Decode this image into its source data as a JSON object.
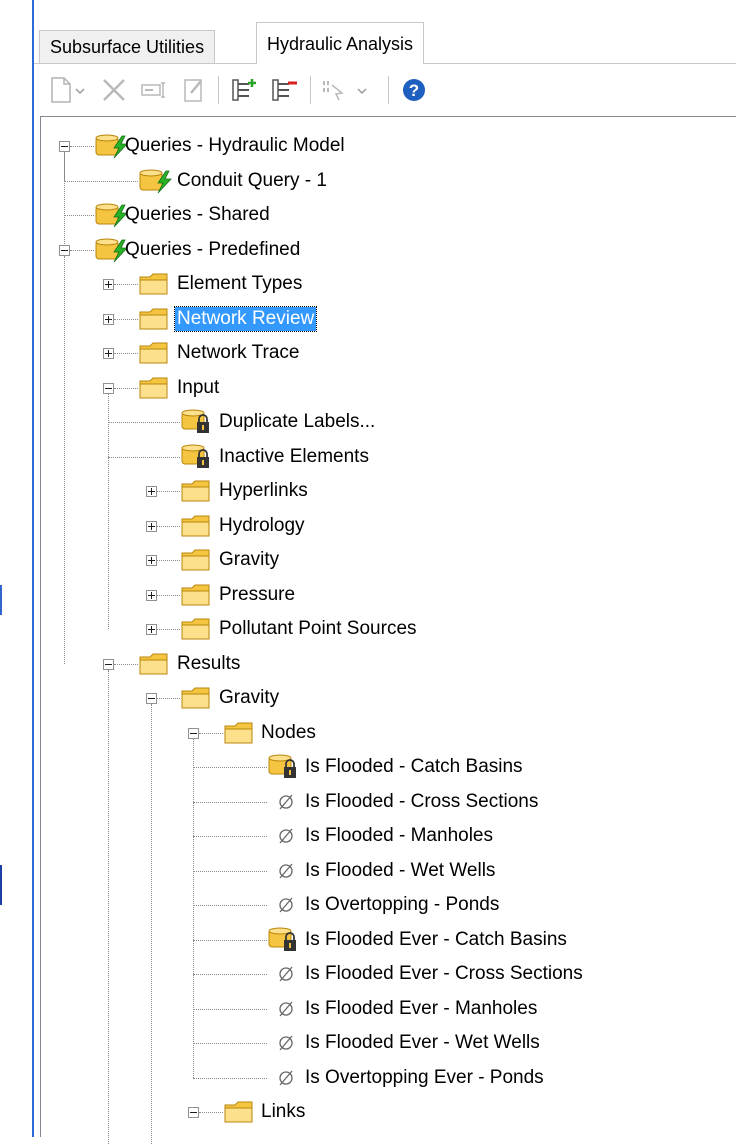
{
  "tabs": [
    {
      "label": "Subsurface Utilities",
      "active": false
    },
    {
      "label": "Hydraulic Analysis",
      "active": true
    }
  ],
  "toolbar": [
    {
      "icon": "new-document-icon",
      "dropdown": true,
      "enabled": false
    },
    {
      "icon": "delete-icon",
      "enabled": false
    },
    {
      "icon": "rename-icon",
      "enabled": false
    },
    {
      "icon": "edit-icon",
      "enabled": false
    },
    {
      "icon": "expand-all-icon",
      "enabled": true
    },
    {
      "icon": "collapse-all-icon",
      "enabled": true
    },
    {
      "icon": "select-icon",
      "dropdown": true,
      "enabled": false
    },
    {
      "icon": "help-icon",
      "enabled": true
    }
  ],
  "tree": [
    {
      "label": "Queries - Hydraulic Model",
      "level": 0,
      "icon": "query-group-icon",
      "expander": "minus"
    },
    {
      "label": "Conduit Query - 1",
      "level": 1,
      "icon": "query-group-icon"
    },
    {
      "label": "Queries - Shared",
      "level": 0,
      "icon": "query-group-icon"
    },
    {
      "label": "Queries - Predefined",
      "level": 0,
      "icon": "query-group-icon",
      "expander": "minus"
    },
    {
      "label": "Element Types",
      "level": 1,
      "icon": "folder-icon",
      "expander": "plus"
    },
    {
      "label": "Network Review",
      "level": 1,
      "icon": "folder-icon",
      "expander": "plus",
      "selected": true
    },
    {
      "label": "Network Trace",
      "level": 1,
      "icon": "folder-icon",
      "expander": "plus"
    },
    {
      "label": "Input",
      "level": 1,
      "icon": "folder-icon",
      "expander": "minus"
    },
    {
      "label": "Duplicate Labels...",
      "level": 2,
      "icon": "locked-query-icon"
    },
    {
      "label": "Inactive Elements",
      "level": 2,
      "icon": "locked-query-icon"
    },
    {
      "label": "Hyperlinks",
      "level": 2,
      "icon": "folder-icon",
      "expander": "plus"
    },
    {
      "label": "Hydrology",
      "level": 2,
      "icon": "folder-icon",
      "expander": "plus"
    },
    {
      "label": "Gravity",
      "level": 2,
      "icon": "folder-icon",
      "expander": "plus"
    },
    {
      "label": "Pressure",
      "level": 2,
      "icon": "folder-icon",
      "expander": "plus"
    },
    {
      "label": "Pollutant Point Sources",
      "level": 2,
      "icon": "folder-icon",
      "expander": "plus"
    },
    {
      "label": "Results",
      "level": 1,
      "icon": "folder-icon",
      "expander": "minus"
    },
    {
      "label": "Gravity",
      "level": 2,
      "icon": "folder-icon",
      "expander": "minus"
    },
    {
      "label": "Nodes",
      "level": 3,
      "icon": "folder-icon",
      "expander": "minus"
    },
    {
      "label": "Is Flooded - Catch Basins",
      "level": 4,
      "icon": "locked-query-icon"
    },
    {
      "label": "Is Flooded - Cross Sections",
      "level": 4,
      "icon": "empty-set-icon"
    },
    {
      "label": "Is Flooded - Manholes",
      "level": 4,
      "icon": "empty-set-icon"
    },
    {
      "label": "Is Flooded - Wet Wells",
      "level": 4,
      "icon": "empty-set-icon"
    },
    {
      "label": "Is Overtopping - Ponds",
      "level": 4,
      "icon": "empty-set-icon"
    },
    {
      "label": "Is Flooded Ever - Catch Basins",
      "level": 4,
      "icon": "locked-query-icon"
    },
    {
      "label": "Is Flooded Ever - Cross Sections",
      "level": 4,
      "icon": "empty-set-icon"
    },
    {
      "label": "Is Flooded Ever - Manholes",
      "level": 4,
      "icon": "empty-set-icon"
    },
    {
      "label": "Is Flooded Ever - Wet Wells",
      "level": 4,
      "icon": "empty-set-icon"
    },
    {
      "label": "Is Overtopping Ever - Ponds",
      "level": 4,
      "icon": "empty-set-icon"
    },
    {
      "label": "Links",
      "level": 3,
      "icon": "folder-icon",
      "expander": "minus"
    }
  ],
  "colors": {
    "selection": "#3399ff",
    "folder": "#f5c542",
    "query_bolt": "#27b227",
    "help": "#1f5fbf"
  }
}
